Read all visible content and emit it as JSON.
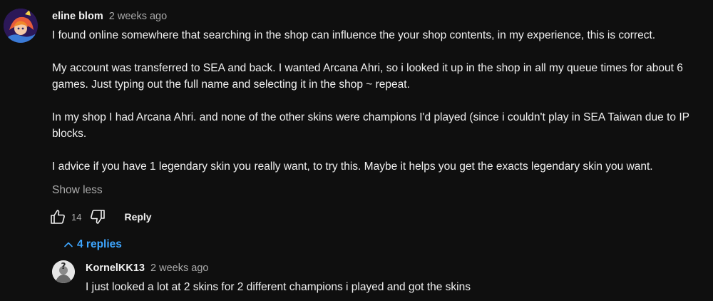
{
  "comment": {
    "author": "eline blom",
    "time": "2 weeks ago",
    "avatar_icon": "anime-avatar-icon",
    "paragraphs": [
      "I found online somewhere that searching in the shop can influence the your shop contents, in my experience, this is correct.",
      "My account was transferred to SEA and back. I wanted Arcana Ahri, so i looked it up in the shop in all my queue times for about 6 games.  Just typing out the full name and selecting it in the shop ~ repeat.",
      "In my shop I had Arcana Ahri. and none of the other skins were champions I'd played (since i couldn't play in SEA Taiwan due to IP blocks.",
      "I advice if you have 1 legendary skin you really want, to try this. Maybe it helps you get the exacts legendary skin you want."
    ],
    "show_less_label": "Show less",
    "like_count": "14",
    "reply_label": "Reply",
    "replies_toggle_label": "4 replies"
  },
  "reply": {
    "author": "KornelKK13",
    "time": "2 weeks ago",
    "avatar_icon": "question-mark-avatar-icon",
    "text": "I just looked a lot at 2 skins for 2 different champions i played and got the skins"
  },
  "colors": {
    "background": "#0f0f0f",
    "text": "#f1f1f1",
    "muted": "#aaaaaa",
    "link": "#3ea6ff"
  }
}
